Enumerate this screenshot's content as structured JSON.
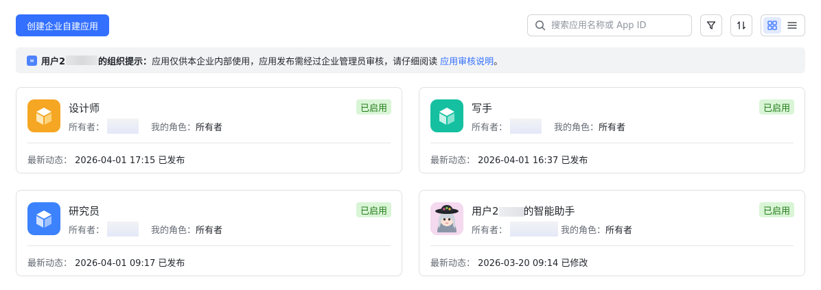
{
  "toolbar": {
    "create_label": "创建企业自建应用",
    "search_placeholder": "搜索应用名称或 App ID"
  },
  "notice": {
    "prefix": "用户2",
    "suffix": "的组织提示：",
    "message": "应用仅供本企业内部使用，应用发布需经过企业管理员审核，请仔细阅读",
    "link": "应用审核说明",
    "end": "。"
  },
  "labels": {
    "owner": "所有者：",
    "my_role": "我的角色：",
    "latest_activity": "最新动态："
  },
  "apps": [
    {
      "name": "设计师",
      "status": "已启用",
      "role": "所有者",
      "activity": "2026-04-01 17:15 已发布",
      "icon": "cube-icon",
      "color": "#f5a623"
    },
    {
      "name": "写手",
      "status": "已启用",
      "role": "所有者",
      "activity": "2026-04-01 16:37 已发布",
      "icon": "cube-icon",
      "color": "#14c0a0"
    },
    {
      "name": "研究员",
      "status": "已启用",
      "role": "所有者",
      "activity": "2026-04-01 09:17 已发布",
      "icon": "cube-icon",
      "color": "#3c82fc"
    },
    {
      "name": "用户2",
      "name_suffix": "的智能助手",
      "status": "已启用",
      "role": "所有者",
      "activity": "2026-03-20 09:14 已修改",
      "icon": "character-avatar-icon",
      "color": "#f4d9ef"
    }
  ]
}
